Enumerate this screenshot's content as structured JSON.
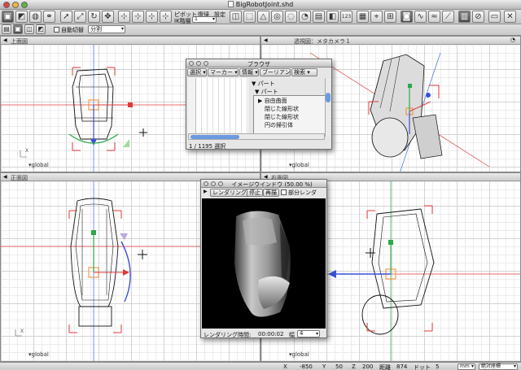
{
  "window": {
    "title": "BigRobotJoint.shd"
  },
  "toolbar": {
    "label_pivot": "ピボット",
    "label_restore": "復帰",
    "label_settings": "設定",
    "label_ik": "IK階層",
    "ik_value": "1",
    "btn_123": "123",
    "auto_switch_label": "自動切替",
    "split_value": "分割"
  },
  "viewports": {
    "top": {
      "title": "上面図",
      "global": "▾global"
    },
    "perspective": {
      "title": "透視図：メタカメラ１",
      "global": "▾global"
    },
    "front": {
      "title": "正面図",
      "global": "▾global"
    },
    "right": {
      "title": "右面図",
      "global": "▾global"
    }
  },
  "browser": {
    "title": "ブラウザ",
    "buttons": [
      "選択",
      "マーカー",
      "情報",
      "ブーリアン",
      "検索"
    ],
    "tree": {
      "root": "パート",
      "child": "パート",
      "items": [
        "自由曲面",
        "閉じた線形状",
        "閉じた線形状",
        "円の掃引体"
      ]
    },
    "status": "1 / 1195 選択"
  },
  "render": {
    "title": "イメージウインドウ (50.00 %)",
    "render_button": "レンダリング",
    "stop_button": "停止",
    "redraw_button": "再描",
    "partial_render": "部分レンダ",
    "time_label": "レンダリング時間:",
    "time_value": "00:00:02",
    "width_label": "幅",
    "width_value": "4"
  },
  "statusbar": {
    "x_label": "X",
    "x_value": "-850",
    "y_label": "Y",
    "y_value": "50",
    "z_label": "Z",
    "z_value": "200",
    "dist_label": "距離",
    "dist_value": "874",
    "dot_label": "ドット",
    "dot_value": "5",
    "unit_value": "mm",
    "coord_mode": "絶対座標"
  },
  "colors": {
    "accent_red": "#e0443b",
    "axis_blue": "#2f3fbf",
    "axis_green": "#2aa84a",
    "handle_orange": "#f08a2c"
  }
}
